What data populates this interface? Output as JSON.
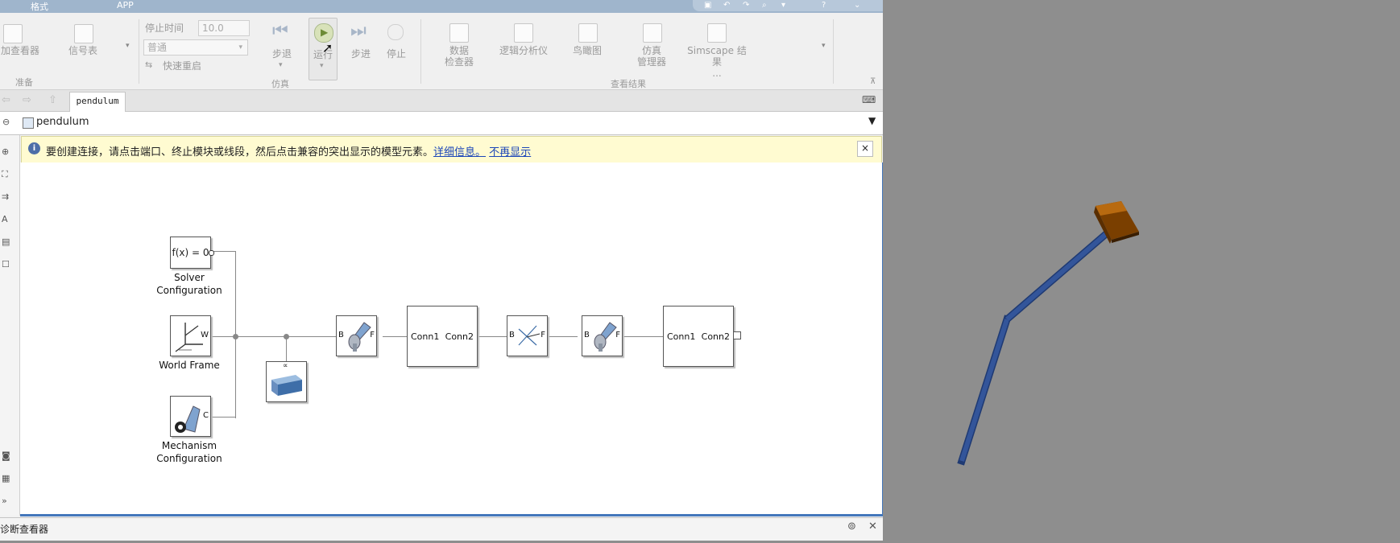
{
  "topbar": {
    "tabs": [
      "格式",
      "APP"
    ]
  },
  "ribbon": {
    "prepare": {
      "items": [
        "加查看器",
        "信号表"
      ],
      "section": "准备"
    },
    "simulate": {
      "stop_time_label": "停止时间",
      "stop_time_value": "10.0",
      "mode_value": "普通",
      "fast_restart": "快速重启",
      "step_back": "步退",
      "run": "运行",
      "step_forward": "步进",
      "stop": "停止",
      "section": "仿真"
    },
    "review": {
      "items": [
        "数据\n检查器",
        "逻辑分析仪",
        "鸟瞰图",
        "仿真\n管理器",
        "Simscape 结\n果\n..."
      ],
      "section": "查看结果"
    }
  },
  "tabbar": {
    "doc_tab": "pendulum"
  },
  "address": {
    "model": "pendulum"
  },
  "info_bar": {
    "message": "要创建连接，请点击端口、终止模块或线段，然后点击兼容的突出显示的模型元素。",
    "link_details": "详细信息。",
    "link_hide": "不再显示",
    "close": "×"
  },
  "blocks": {
    "solver": {
      "content": "f(x) = 0",
      "name": "Solver\nConfiguration"
    },
    "world": {
      "port": "W",
      "name": "World Frame"
    },
    "mechanism": {
      "port": "C",
      "name": "Mechanism\nConfiguration"
    },
    "gravity_symbol": "∝",
    "revolute1": {
      "b": "B",
      "f": "F"
    },
    "link1": {
      "conn1": "Conn1",
      "conn2": "Conn2"
    },
    "transform": {
      "b": "B",
      "f": "F"
    },
    "revolute2": {
      "b": "B",
      "f": "F"
    },
    "link2": {
      "conn1": "Conn1",
      "conn2": "Conn2"
    }
  },
  "diagnostics": {
    "title": "诊断查看器"
  },
  "colors": {
    "accent_border": "#4477bb",
    "info_bg": "#fffbd1",
    "rod": "#33559a",
    "mass": "#9a5200"
  }
}
